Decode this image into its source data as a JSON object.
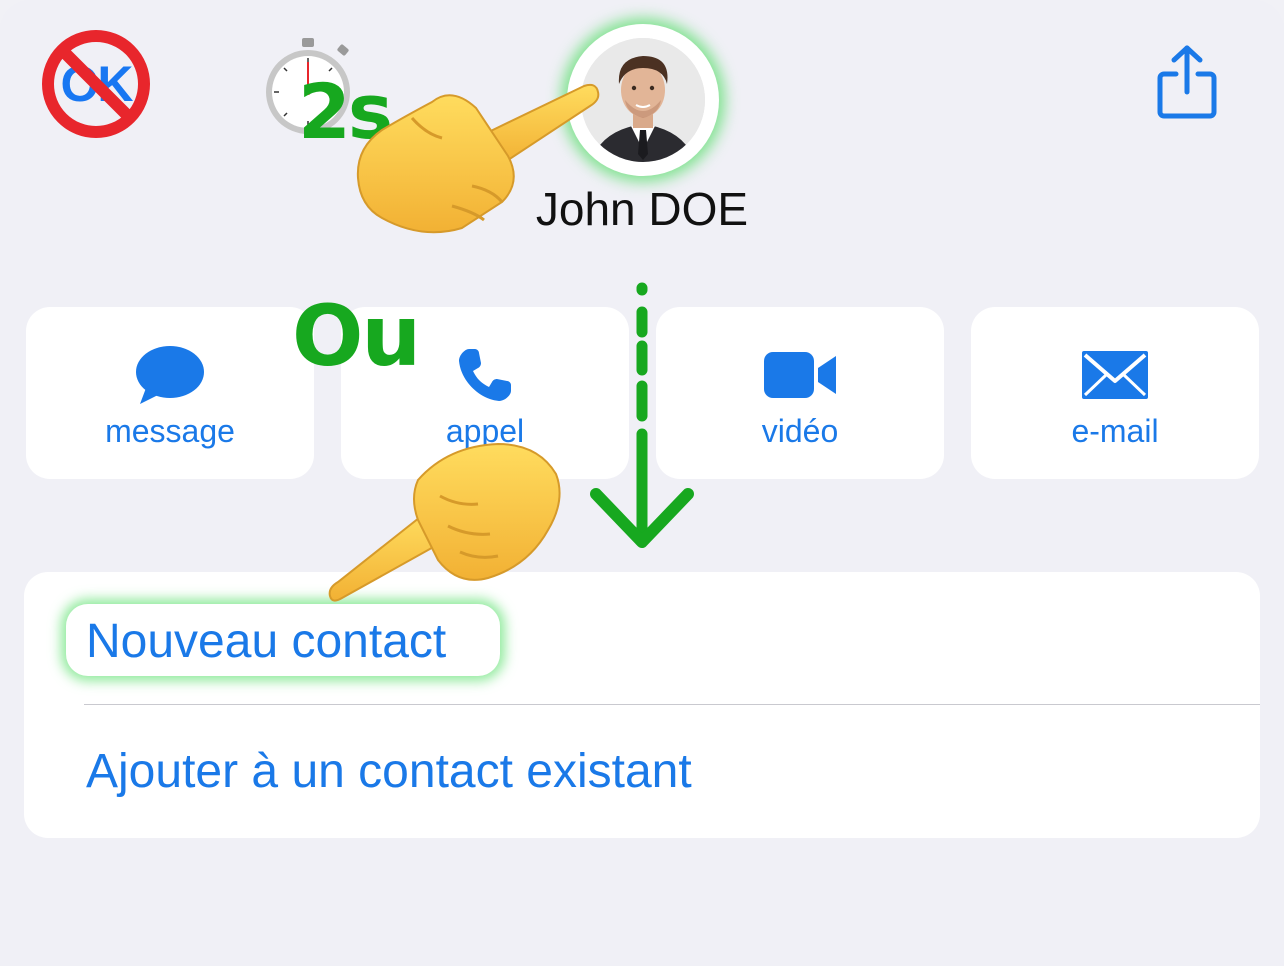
{
  "header": {
    "ok_button_text": "OK",
    "timer_label": "2s.",
    "share_icon": "share-icon"
  },
  "contact": {
    "name": "John DOE",
    "avatar_icon": "avatar-photo"
  },
  "actions": [
    {
      "label": "message",
      "icon": "message-bubble-icon"
    },
    {
      "label": "appel",
      "icon": "phone-icon"
    },
    {
      "label": "vidéo",
      "icon": "video-camera-icon"
    },
    {
      "label": "e-mail",
      "icon": "envelope-icon"
    }
  ],
  "annotations": {
    "or_label": "Ou"
  },
  "list": {
    "new_contact": "Nouveau contact",
    "add_to_existing": "Ajouter à un contact existant"
  },
  "colors": {
    "accent_blue": "#1a79e8",
    "annotation_green": "#17a81f",
    "background": "#f0f0f6",
    "card": "#ffffff"
  }
}
